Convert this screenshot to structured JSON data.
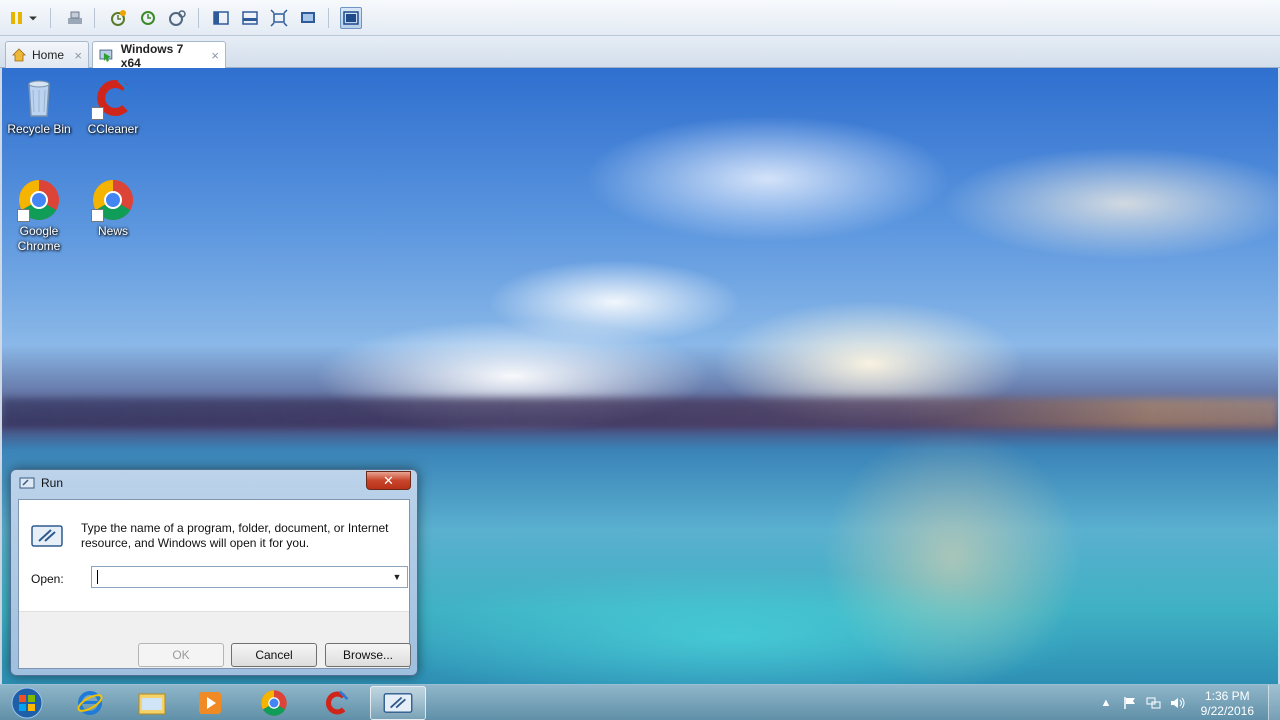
{
  "toolbar": {
    "buttons": [
      "pause-icon",
      "dropdown-icon",
      "send-ctrl-alt-del-icon",
      "snapshot-icon",
      "revert-snapshot-icon",
      "snapshot-manager-icon",
      "normal-view-icon",
      "fullscreen-icon",
      "fit-guest-icon",
      "console-view-icon",
      "unity-icon"
    ]
  },
  "tabs": {
    "home": {
      "label": "Home",
      "close": "×"
    },
    "vm": {
      "label": "Windows 7 x64",
      "close": "×"
    }
  },
  "desktop": {
    "icons": [
      {
        "label": "Recycle Bin",
        "icon": "recycle-bin-icon"
      },
      {
        "label": "CCleaner",
        "icon": "ccleaner-icon"
      },
      {
        "label": "Google Chrome",
        "icon": "chrome-icon"
      },
      {
        "label": "News",
        "icon": "chrome-icon"
      }
    ]
  },
  "run_dialog": {
    "title": "Run",
    "close": "✕",
    "description": "Type the name of a program, folder, document, or Internet resource, and Windows will open it for you.",
    "open_label": "Open:",
    "open_value": "",
    "ok_label": "OK",
    "cancel_label": "Cancel",
    "browse_label": "Browse..."
  },
  "taskbar": {
    "apps": [
      "internet-explorer-icon",
      "windows-explorer-icon",
      "media-player-icon",
      "chrome-icon",
      "ccleaner-icon",
      "run-icon"
    ],
    "clock_time": "1:36 PM",
    "clock_date": "9/22/2016"
  },
  "colors": {
    "accent": "#6f95c2",
    "close_red": "#c8442a",
    "taskbar": "#5a8ca5"
  }
}
